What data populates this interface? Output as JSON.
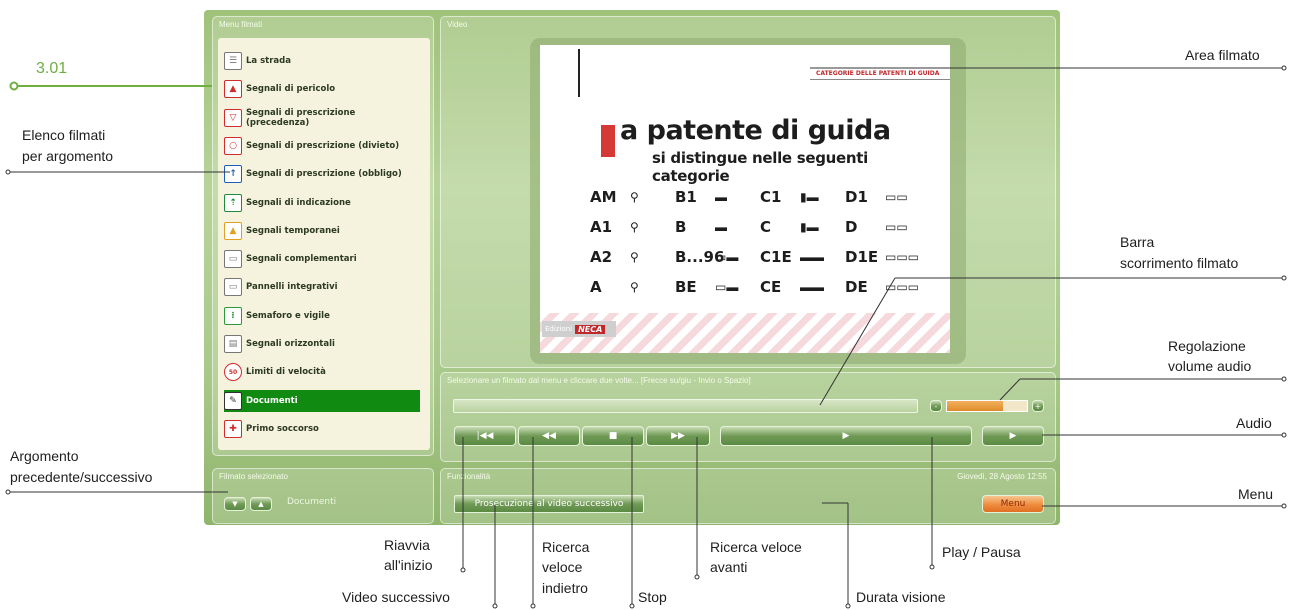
{
  "panels": {
    "menu_title": "Menu filmati",
    "video_title": "Video",
    "selected_title": "Filmato selezionato",
    "func_title": "Funzionalità"
  },
  "menu_items": [
    {
      "label": "La strada",
      "icon": "road-icon",
      "color": "#777777"
    },
    {
      "label": "Segnali di pericolo",
      "icon": "warning-triangle-icon",
      "color": "#d22b2b"
    },
    {
      "label": "Segnali di prescrizione (precedenza)",
      "icon": "yield-icon",
      "color": "#d22b2b"
    },
    {
      "label": "Segnali di prescrizione (divieto)",
      "icon": "prohibition-icon",
      "color": "#d22b2b"
    },
    {
      "label": "Segnali di prescrizione (obbligo)",
      "icon": "mandatory-arrow-icon",
      "color": "#1a5fb4"
    },
    {
      "label": "Segnali di indicazione",
      "icon": "direction-sign-icon",
      "color": "#1f8a3a"
    },
    {
      "label": "Segnali temporanei",
      "icon": "roadwork-icon",
      "color": "#e0a020"
    },
    {
      "label": "Segnali complementari",
      "icon": "complementary-sign-icon",
      "color": "#777777"
    },
    {
      "label": "Pannelli integrativi",
      "icon": "panel-icon",
      "color": "#777777"
    },
    {
      "label": "Semaforo e vigile",
      "icon": "traffic-light-icon",
      "color": "#2a9a3a"
    },
    {
      "label": "Segnali orizzontali",
      "icon": "horizontal-sign-icon",
      "color": "#777777"
    },
    {
      "label": "Limiti di velocità",
      "icon": "speed-limit-icon",
      "color": "#d22b2b"
    },
    {
      "label": "Documenti",
      "icon": "document-icon",
      "color": "#333333",
      "selected": true
    },
    {
      "label": "Primo soccorso",
      "icon": "first-aid-icon",
      "color": "#d22b2b"
    }
  ],
  "speed_limit_text": "50",
  "selected_film": "Documenti",
  "status_text": "Selezionare un filmato dal menu e cliccare due volte... [Frecce su/giu - Invio o Spazio]",
  "datetime": "Giovedì, 28 Agosto 12:55",
  "next_video_label": "Prosecuzione al video successivo",
  "menu_button_label": "Menu",
  "volume_minus": "-",
  "volume_plus": "+",
  "volume_level": 0.7,
  "slide": {
    "header": "CATEGORIE DELLE PATENTI DI GUIDA",
    "big_letter": "L",
    "title_rest": "a patente di guida",
    "subtitle": "si distingue nelle seguenti categorie",
    "categories": [
      [
        "AM",
        "B1",
        "C1",
        "D1"
      ],
      [
        "A1",
        "B",
        "C",
        "D"
      ],
      [
        "A2",
        "B...96",
        "C1E",
        "D1E"
      ],
      [
        "A",
        "BE",
        "CE",
        "DE"
      ]
    ],
    "publisher_prefix": "Edizioni",
    "publisher_name": "NECA"
  },
  "callouts": {
    "section_number": "3.01",
    "elenco_line1": "Elenco filmati",
    "elenco_line2": "per argomento",
    "argomento_line1": "Argomento",
    "argomento_line2": "precedente/successivo",
    "area_filmato": "Area filmato",
    "barra_line1": "Barra",
    "barra_line2": "scorrimento filmato",
    "volume_line1": "Regolazione",
    "volume_line2": "volume audio",
    "audio": "Audio",
    "menu": "Menu",
    "riavvia_line1": "Riavvia",
    "riavvia_line2": "all'inizio",
    "video_successivo": "Video successivo",
    "ricerca_ind_line1": "Ricerca",
    "ricerca_ind_line2": "veloce",
    "ricerca_ind_line3": "indietro",
    "stop": "Stop",
    "ricerca_av_line1": "Ricerca veloce",
    "ricerca_av_line2": "avanti",
    "play_pausa": "Play / Pausa",
    "durata": "Durata visione"
  }
}
